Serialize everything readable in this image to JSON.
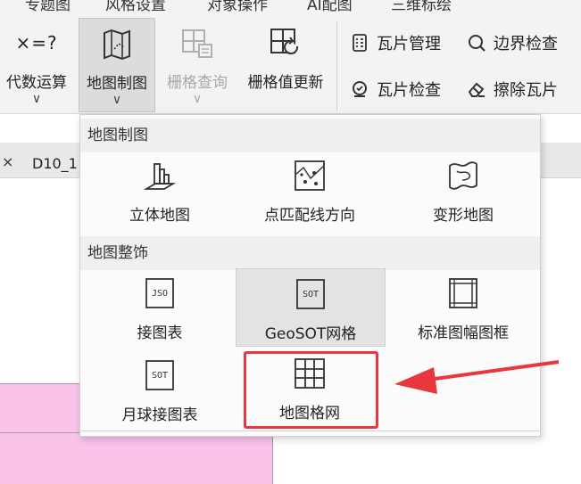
{
  "ribbon": {
    "tabs": [
      "专题图",
      "风格设置",
      "对象操作",
      "AI配图",
      "三维标绘"
    ],
    "buttons": [
      {
        "label": "代数运算",
        "chevron": "∨",
        "icon": "algebra-icon"
      },
      {
        "label": "地图制图",
        "chevron": "∨",
        "icon": "map-drawing-icon"
      },
      {
        "label": "栅格查询",
        "chevron": "∨",
        "icon": "raster-query-icon"
      },
      {
        "label": "栅格值更新",
        "icon": "raster-update-icon"
      }
    ],
    "algebra_glyph": "×=?",
    "small_buttons": [
      {
        "label": "瓦片管理",
        "icon": "tile-manage-icon"
      },
      {
        "label": "边界检查",
        "icon": "boundary-check-icon"
      },
      {
        "label": "瓦片检查",
        "icon": "tile-check-icon"
      },
      {
        "label": "擦除瓦片",
        "icon": "erase-tile-icon"
      }
    ]
  },
  "document": {
    "close_glyph": "×",
    "tab_label": "D10_1"
  },
  "dropdown": {
    "section1": {
      "title": "地图制图",
      "items": [
        {
          "label": "立体地图",
          "icon": "3d-map-icon"
        },
        {
          "label": "点匹配线方向",
          "icon": "point-line-direction-icon"
        },
        {
          "label": "变形地图",
          "icon": "deformed-map-icon"
        }
      ]
    },
    "section2": {
      "title": "地图整饰",
      "items": [
        {
          "label": "接图表",
          "icon": "json-index-icon",
          "glyph": "JSO"
        },
        {
          "label": "GeoSOT网格",
          "icon": "geosot-grid-icon",
          "glyph": "SOT"
        },
        {
          "label": "标准图幅图框",
          "icon": "standard-frame-icon"
        },
        {
          "label": "月球接图表",
          "icon": "moon-index-icon",
          "glyph": "SOT"
        },
        {
          "label": "地图格网",
          "icon": "map-grid-icon"
        }
      ]
    }
  },
  "colors": {
    "highlight_border": "#e8383d",
    "pink_fill": "#f9c3ea",
    "ribbon_bg": "#f3f3f3"
  }
}
